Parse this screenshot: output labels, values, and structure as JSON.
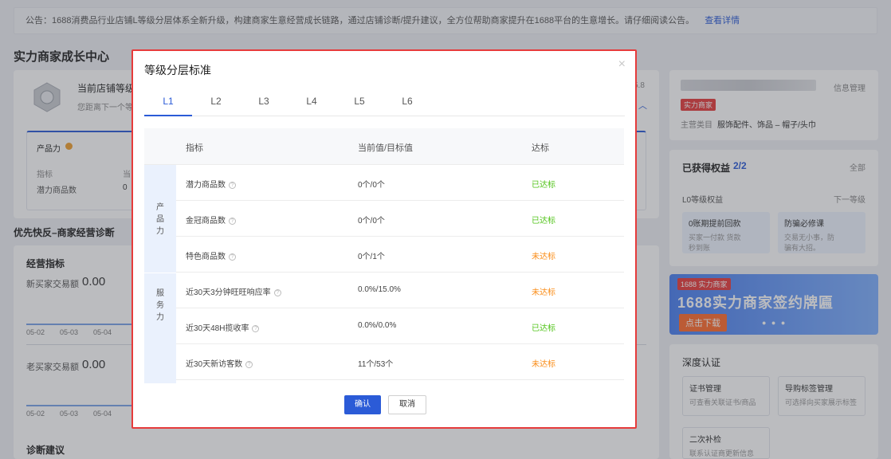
{
  "notice": {
    "text": "公告：1688消费品行业店铺L等级分层体系全新升级，构建商家生意经营成长链路，通过店铺诊断/提升建议，全方位帮助商家提升在1688平台的生意增长。请仔细阅读公告。",
    "link": "查看详情"
  },
  "page_title": "实力商家成长中心",
  "store_card": {
    "level_title": "当前店铺等级",
    "distance": "您距离下一个等",
    "version": "5.8",
    "product_power": "产品力",
    "metric_label": "指标",
    "metric_label2": "当",
    "potential_label": "潜力商品数",
    "potential_value": "0"
  },
  "diagnosis": {
    "heading": "优先快反–商家经营诊断",
    "ops_heading": "经营指标",
    "new_buyer_label": "新买家交易额",
    "new_buyer_value": "0.00",
    "old_buyer_label": "老买家交易额",
    "old_buyer_value": "0.00",
    "dates": [
      "05-02",
      "05-03",
      "05-04"
    ],
    "advice_heading": "诊断建议"
  },
  "merchant": {
    "info_link": "信息管理",
    "badge": "实力商家",
    "category_label": "主营类目",
    "category_value": "服饰配件、饰品 – 帽子/头巾"
  },
  "benefits": {
    "heading": "已获得权益",
    "count": "2/2",
    "all": "全部",
    "level_label": "L0等级权益",
    "next_level": "下一等级",
    "items": [
      {
        "title": "0账期提前回款",
        "desc": "买家一付款 货款秒到账"
      },
      {
        "title": "防骗必修课",
        "desc": "交易无小事，防骗有大招。"
      }
    ]
  },
  "banner": {
    "tag": "1688 实力商家",
    "title": "1688实力商家签约牌匾",
    "button": "点击下载"
  },
  "auth": {
    "heading": "深度认证",
    "items": [
      {
        "title": "证书管理",
        "desc": "可查看关联证书/商品"
      },
      {
        "title": "导购标签管理",
        "desc": "可选择向买家展示标签"
      },
      {
        "title": "二次补检",
        "desc": "联系认证商更新信息"
      }
    ]
  },
  "modal": {
    "title": "等级分层标准",
    "close": "×",
    "tabs": [
      "L1",
      "L2",
      "L3",
      "L4",
      "L5",
      "L6"
    ],
    "active_tab": "L1",
    "columns": {
      "metric": "指标",
      "value": "当前值/目标值",
      "status": "达标"
    },
    "groups": [
      {
        "name_chars": [
          "产",
          "品",
          "力"
        ]
      },
      {
        "name_chars": [
          "服",
          "务",
          "力"
        ]
      }
    ],
    "rows": [
      {
        "metric": "潜力商品数",
        "value": "0个/0个",
        "status": "已达标",
        "ok": true
      },
      {
        "metric": "金冠商品数",
        "value": "0个/0个",
        "status": "已达标",
        "ok": true
      },
      {
        "metric": "特色商品数",
        "value": "0个/1个",
        "status": "未达标",
        "ok": false
      },
      {
        "metric": "近30天3分钟旺旺响应率",
        "value": "0.0%/15.0%",
        "status": "未达标",
        "ok": false
      },
      {
        "metric": "近30天48H揽收率",
        "value": "0.0%/0.0%",
        "status": "已达标",
        "ok": true
      },
      {
        "metric": "近30天新访客数",
        "value": "11个/53个",
        "status": "未达标",
        "ok": false
      }
    ],
    "confirm": "确认",
    "cancel": "取消"
  },
  "colors": {
    "accent": "#2b5bd7",
    "ok": "#52c41a",
    "warn": "#fa8c16",
    "highlight_border": "#e63b3b"
  }
}
